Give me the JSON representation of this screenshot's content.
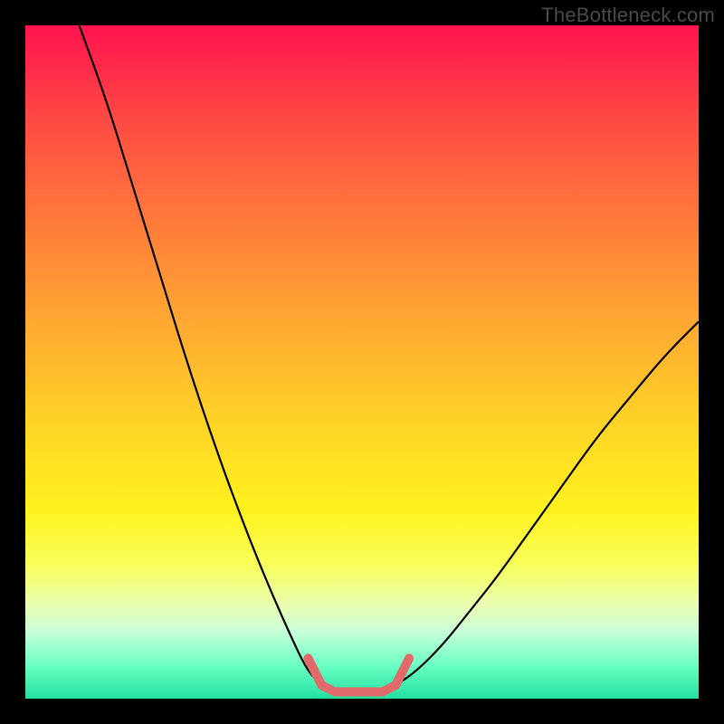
{
  "watermark": "TheBottleneck.com",
  "colors": {
    "background": "#000000",
    "curve_black": "#000000",
    "highlight_pink": "#e36a6a"
  },
  "chart_data": {
    "type": "line",
    "title": "",
    "xlabel": "",
    "ylabel": "",
    "xlim": [
      0,
      100
    ],
    "ylim": [
      0,
      100
    ],
    "series": [
      {
        "name": "left-curve",
        "x": [
          8,
          12,
          16,
          20,
          24,
          28,
          32,
          36,
          40,
          42,
          44
        ],
        "y": [
          100,
          89,
          76,
          63,
          50,
          38,
          27,
          17,
          8,
          4,
          2
        ]
      },
      {
        "name": "right-curve",
        "x": [
          55,
          58,
          62,
          66,
          70,
          75,
          80,
          85,
          90,
          95,
          100
        ],
        "y": [
          2,
          4,
          8,
          13,
          18,
          25,
          32,
          39,
          45,
          51,
          56
        ]
      },
      {
        "name": "trough-highlight",
        "x": [
          42,
          44,
          46,
          50,
          53,
          55,
          57
        ],
        "y": [
          6,
          2,
          1,
          1,
          1,
          2,
          6
        ]
      }
    ],
    "annotations": []
  }
}
